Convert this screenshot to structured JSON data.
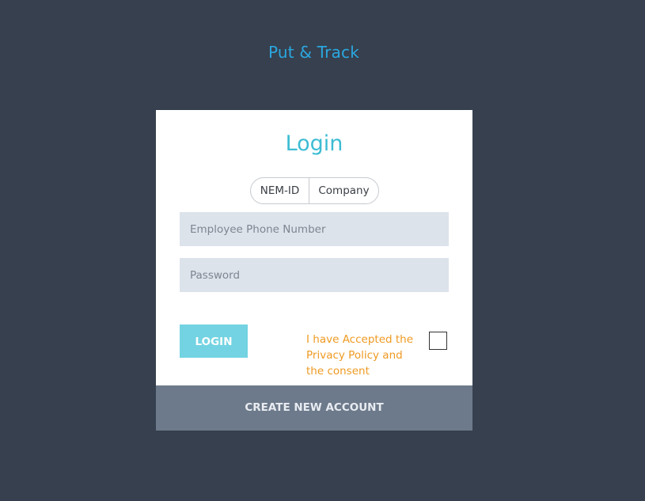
{
  "brand": {
    "title": "Put & Track",
    "color": "#2ba7e0"
  },
  "login_card": {
    "title": "Login",
    "auth_modes": [
      "NEM-ID",
      "Company"
    ],
    "phone_field": {
      "placeholder": "Employee Phone Number",
      "value": ""
    },
    "password_field": {
      "placeholder": "Password",
      "value": ""
    },
    "login_button": "LOGIN",
    "consent": {
      "label": "I have Accepted the Privacy Policy and the consent",
      "checked": false
    },
    "create_account": "CREATE NEW ACCOUNT"
  },
  "colors": {
    "background": "#36404e",
    "accent": "#3cbcd3",
    "login_button": "#73d3e2",
    "consent_text": "#ef9a22",
    "footer_bar": "#6d7a8b"
  }
}
